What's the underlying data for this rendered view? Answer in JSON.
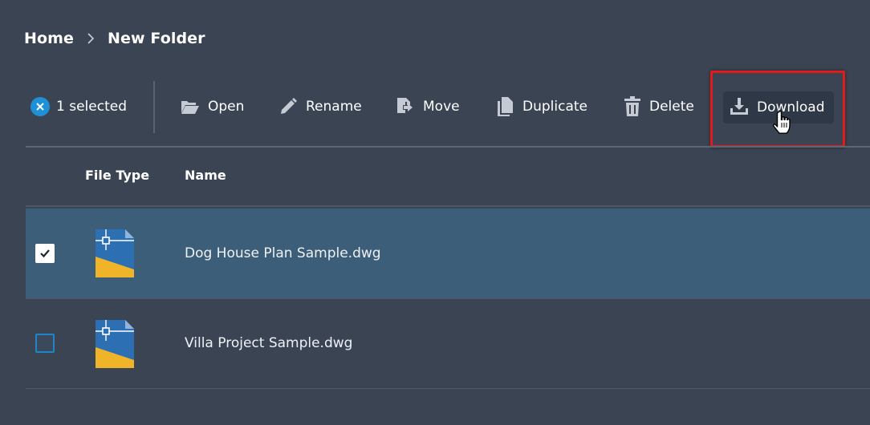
{
  "breadcrumb": {
    "home": "Home",
    "current": "New Folder"
  },
  "toolbar": {
    "selection_count": "1 selected",
    "open": "Open",
    "rename": "Rename",
    "move": "Move",
    "duplicate": "Duplicate",
    "delete": "Delete",
    "download": "Download"
  },
  "table": {
    "columns": [
      "File Type",
      "Name"
    ],
    "rows": [
      {
        "name": "Dog House Plan Sample.dwg",
        "selected": true,
        "icon": "dwg-file-icon"
      },
      {
        "name": "Villa Project Sample.dwg",
        "selected": false,
        "icon": "dwg-file-icon"
      }
    ]
  },
  "colors": {
    "background": "#3b4453",
    "selected_row": "#3d5e78",
    "accent_blue": "#1e90d8",
    "highlight_red": "#e21a1a",
    "icon_yellow": "#f0b429",
    "icon_blue": "#2d6fb3"
  }
}
